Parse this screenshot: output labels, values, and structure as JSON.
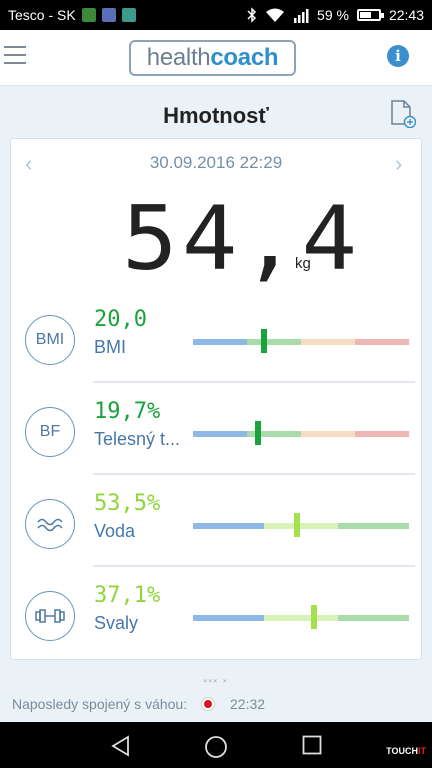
{
  "status_bar": {
    "carrier": "Tesco - SK",
    "battery_percent": "59 %",
    "battery_level": 0.59,
    "time": "22:43",
    "icons": [
      "bluetooth-icon",
      "wifi-icon",
      "signal-icon",
      "battery-icon"
    ]
  },
  "app_bar": {
    "logo_part1": "health",
    "logo_part2": "coach",
    "info_label": "i"
  },
  "page": {
    "title": "Hmotnosť",
    "date": "30.09.2016 22:29",
    "prev_label": "‹",
    "next_label": "›",
    "weight": "54,4",
    "unit": "kg"
  },
  "metrics": [
    {
      "icon_text": "BMI",
      "icon": "bmi-icon",
      "value": "20,0",
      "label": "BMI",
      "value_color": "#1aa33b",
      "marker_color": "#1aa33b",
      "marker_pos": 0.33,
      "segments": [
        {
          "color": "#8db8e6",
          "frac": 0.25
        },
        {
          "color": "#a9dca8",
          "frac": 0.25
        },
        {
          "color": "#f6dcc0",
          "frac": 0.25
        },
        {
          "color": "#efb6b6",
          "frac": 0.25
        }
      ]
    },
    {
      "icon_text": "BF",
      "icon": "body-fat-icon",
      "value": "19,7%",
      "label": "Telesný t...",
      "value_color": "#1aa33b",
      "marker_color": "#1aa33b",
      "marker_pos": 0.3,
      "segments": [
        {
          "color": "#8db8e6",
          "frac": 0.25
        },
        {
          "color": "#a9dca8",
          "frac": 0.25
        },
        {
          "color": "#f6dcc0",
          "frac": 0.25
        },
        {
          "color": "#efb6b6",
          "frac": 0.25
        }
      ]
    },
    {
      "icon_text": "",
      "icon": "water-icon",
      "value": "53,5%",
      "label": "Voda",
      "value_color": "#8ed63a",
      "marker_color": "#a5e04d",
      "marker_pos": 0.48,
      "segments": [
        {
          "color": "#8db8e6",
          "frac": 0.33
        },
        {
          "color": "#d9f2b9",
          "frac": 0.34
        },
        {
          "color": "#a9dca8",
          "frac": 0.33
        }
      ]
    },
    {
      "icon_text": "",
      "icon": "muscle-icon",
      "value": "37,1%",
      "label": "Svaly",
      "value_color": "#8ed63a",
      "marker_color": "#a5e04d",
      "marker_pos": 0.56,
      "segments": [
        {
          "color": "#8db8e6",
          "frac": 0.33
        },
        {
          "color": "#d9f2b9",
          "frac": 0.34
        },
        {
          "color": "#a9dca8",
          "frac": 0.33
        }
      ]
    }
  ],
  "footer": {
    "scroll_hint": "˟˟˟ ˟",
    "last_connected_label": "Naposledy spojený s váhou:",
    "last_connected_time": "22:32"
  },
  "watermark": {
    "part1": "TOUCH",
    "part2": "IT"
  }
}
